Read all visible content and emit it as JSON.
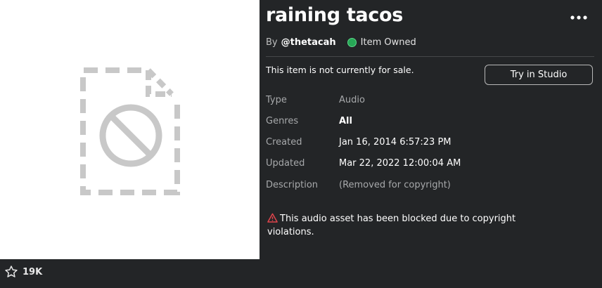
{
  "item": {
    "title": "raining tacos",
    "by_label": "By",
    "creator": "@thetacah",
    "owned_label": "Item Owned"
  },
  "favorites": {
    "count": "19K",
    "icon": "star-outline-icon"
  },
  "menu": {
    "icon": "more-options-icon",
    "glyph": "•••"
  },
  "sale": {
    "status": "This item is not currently for sale.",
    "try_button": "Try in Studio"
  },
  "details": {
    "type_label": "Type",
    "type_value": "Audio",
    "genres_label": "Genres",
    "genres_value": "All",
    "created_label": "Created",
    "created_value": "Jan 16, 2014 6:57:23 PM",
    "updated_label": "Updated",
    "updated_value": "Mar 22, 2022 12:00:04 AM",
    "description_label": "Description",
    "description_value": "(Removed for copyright)"
  },
  "warning": {
    "text": "This audio asset has been blocked due to copyright violations.",
    "icon": "warning-triangle-icon"
  },
  "thumbnail": {
    "icon": "blocked-file-icon"
  },
  "colors": {
    "background": "#232527",
    "owned": "#27a756",
    "warning": "#e0454c"
  }
}
